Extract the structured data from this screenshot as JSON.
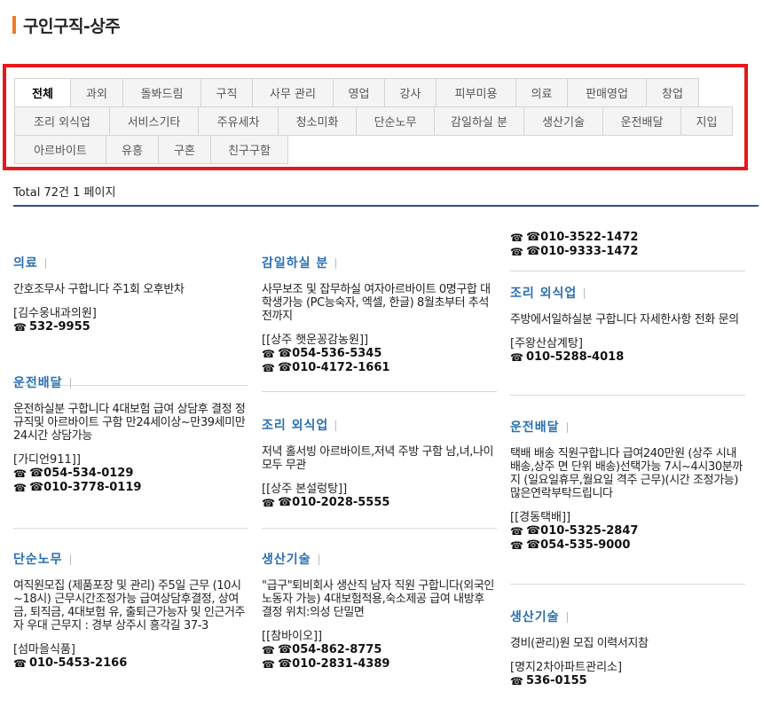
{
  "page_title": "구인구직-상주",
  "categories": {
    "row1": [
      "전체",
      "과외",
      "돌봐드림",
      "구직",
      "사무 관리",
      "영업",
      "강사",
      "피부미용",
      "의료",
      "판매영업",
      "창업"
    ],
    "row2": [
      "조리 외식업",
      "서비스기타",
      "주유세차",
      "청소미화",
      "단순노무",
      "감일하실 분",
      "생산기술",
      "운전배달",
      "지입"
    ],
    "row3": [
      "아르바이트",
      "유흥",
      "구혼",
      "친구구함"
    ]
  },
  "total_text": "Total 72건 1 페이지",
  "phone_icon": "phone-icon",
  "col1": [
    {
      "category": "의료",
      "desc": "간호조무사 구합니다 주1회 오후반차",
      "company": "[김수웅내과의원]",
      "phones": [
        "532-9955"
      ]
    },
    {
      "category": "운전배달",
      "desc": "운전하실분 구합니다 4대보험 급여 상담후 결정 정규직및 아르바이트 구함 만24세이상~만39세미만 24시간 상담가능",
      "company": "[가디언911]]",
      "phones": [
        "☎054-534-0129",
        "☎010-3778-0119"
      ]
    },
    {
      "category": "단순노무",
      "desc": "여직원모집 (제품포장 및 관리) 주5일 근무 (10시~18시) 근무시간조정가능 급여상담후결정, 상여금, 퇴직금, 4대보험 유, 출퇴근가능자 및 인근거주자 우대 근무지 : 경부 상주시 흥각길 37-3",
      "company": "[섬마을식품]",
      "phones": [
        "010-5453-2166"
      ]
    }
  ],
  "col2": [
    {
      "category": "감일하실 분",
      "desc": "사무보조 및 잡무하실 여자아르바이트 0명구합 대학생가능 (PC능숙자, 엑셀, 한글) 8월초부터 추석전까지",
      "company": "[[상주 햇운꽁감농원]]",
      "phones": [
        "☎054-536-5345",
        "☎010-4172-1661"
      ]
    },
    {
      "category": "조리 외식업",
      "desc": "저녁 홀서빙 아르바이트,저녁 주방 구함 남,녀,나이 모두 무관",
      "company": "[[상주 본설렁탕]]",
      "phones": [
        "☎010-2028-5555"
      ]
    },
    {
      "category": "생산기술",
      "desc": "\"급구\"퇴비회사 생산직 남자 직원 구합니다(외국인 노동자 가능) 4대보험적용,숙소제공 급여 내방후 결정 위치:의성 단밀면",
      "company": "[[참바이오]]",
      "phones": [
        "☎054-862-8775",
        "☎010-2831-4389"
      ]
    }
  ],
  "col3_top_phones": [
    "☎010-3522-1472",
    "☎010-9333-1472"
  ],
  "col3": [
    {
      "category": "조리 외식업",
      "desc": "주방에서일하실분 구합니다 자세한사항 전화 문의",
      "company": "[주왕산삼계탕]",
      "phones": [
        "010-5288-4018"
      ]
    },
    {
      "category": "운전배달",
      "desc": "택배 배송 직원구합니다 급여240만원 (상주 시내배송,상주 면 단위 배송)선택가능 7시~4시30분까지 (일요일휴무,월요일 격주 근무)(시간 조정가능) 많은연락부탁드립니다",
      "company": "[[경동택배]]",
      "phones": [
        "☎010-5325-2847",
        "☎054-535-9000"
      ]
    },
    {
      "category": "생산기술",
      "desc": "경비(관리)원 모집 이력서지참",
      "company": "[명지2차아파트관리소]",
      "phones": [
        "536-0155"
      ]
    }
  ]
}
